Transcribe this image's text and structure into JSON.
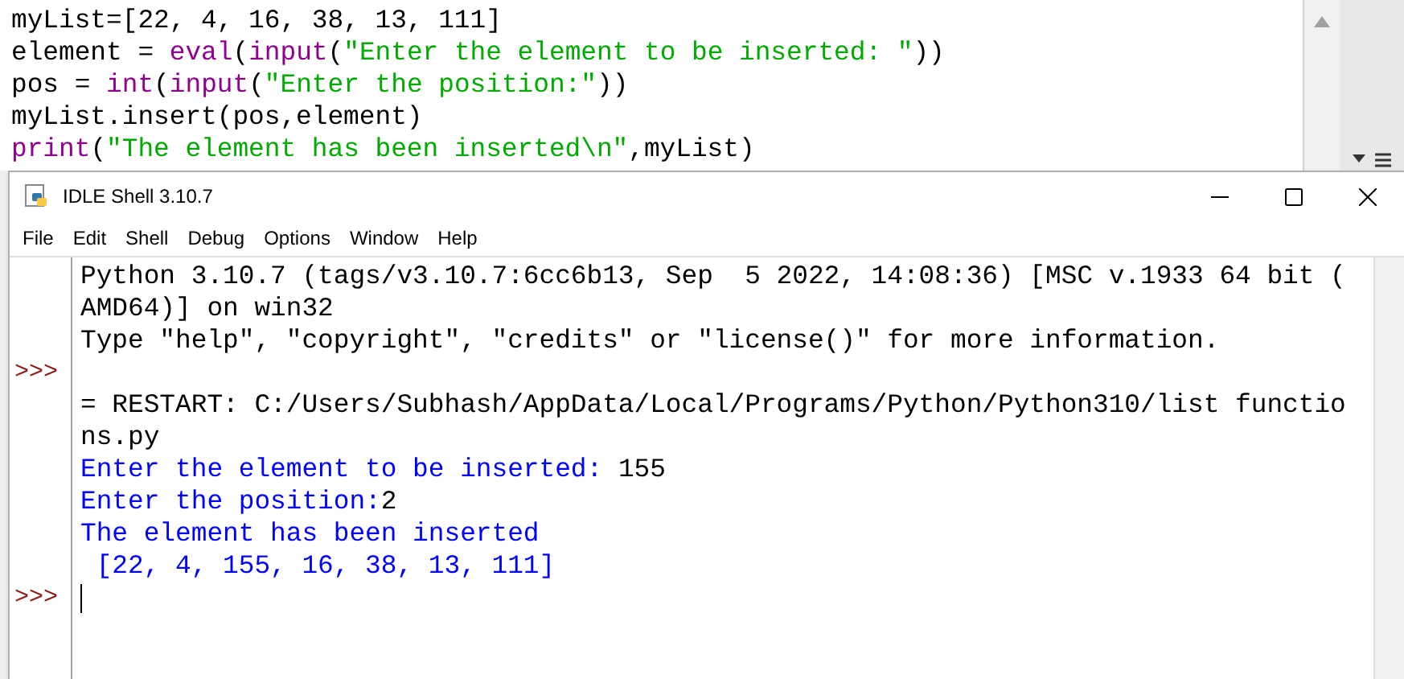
{
  "editor": {
    "lines": [
      {
        "segments": [
          {
            "text": "myList=[22, 4, 16, 38, 13, 111]",
            "kind": "plain"
          }
        ]
      },
      {
        "segments": [
          {
            "text": "element = ",
            "kind": "plain"
          },
          {
            "text": "eval",
            "kind": "builtin"
          },
          {
            "text": "(",
            "kind": "plain"
          },
          {
            "text": "input",
            "kind": "builtin"
          },
          {
            "text": "(",
            "kind": "plain"
          },
          {
            "text": "\"Enter the element to be inserted: \"",
            "kind": "string"
          },
          {
            "text": "))",
            "kind": "plain"
          }
        ]
      },
      {
        "segments": [
          {
            "text": "pos = ",
            "kind": "plain"
          },
          {
            "text": "int",
            "kind": "builtin"
          },
          {
            "text": "(",
            "kind": "plain"
          },
          {
            "text": "input",
            "kind": "builtin"
          },
          {
            "text": "(",
            "kind": "plain"
          },
          {
            "text": "\"Enter the position:\"",
            "kind": "string"
          },
          {
            "text": "))",
            "kind": "plain"
          }
        ]
      },
      {
        "segments": [
          {
            "text": "myList.insert(pos,element)",
            "kind": "plain"
          }
        ]
      },
      {
        "segments": [
          {
            "text": "print",
            "kind": "builtin"
          },
          {
            "text": "(",
            "kind": "plain"
          },
          {
            "text": "\"The element has been inserted\\n\"",
            "kind": "string"
          },
          {
            "text": ",myList)",
            "kind": "plain"
          }
        ]
      }
    ]
  },
  "shell": {
    "title": "IDLE Shell 3.10.7",
    "menu": [
      "File",
      "Edit",
      "Shell",
      "Debug",
      "Options",
      "Window",
      "Help"
    ],
    "lines": [
      {
        "segments": [
          {
            "text": "Python 3.10.7 (tags/v3.10.7:6cc6b13, Sep  5 2022, 14:08:36) [MSC v.1933 64 bit (",
            "kind": "plain"
          }
        ]
      },
      {
        "segments": [
          {
            "text": "AMD64)] on win32",
            "kind": "plain"
          }
        ]
      },
      {
        "segments": [
          {
            "text": "Type \"help\", \"copyright\", \"credits\" or \"license()\" for more information.",
            "kind": "plain"
          }
        ]
      },
      {
        "prompt": ">>>"
      },
      {
        "segments": [
          {
            "text": "= RESTART: C:/Users/Subhash/AppData/Local/Programs/Python/Python310/list functio",
            "kind": "plain"
          }
        ]
      },
      {
        "segments": [
          {
            "text": "ns.py",
            "kind": "plain"
          }
        ]
      },
      {
        "segments": [
          {
            "text": "Enter the element to be inserted: ",
            "kind": "stdout"
          },
          {
            "text": "155",
            "kind": "stdin"
          }
        ]
      },
      {
        "segments": [
          {
            "text": "Enter the position:",
            "kind": "stdout"
          },
          {
            "text": "2",
            "kind": "stdin"
          }
        ]
      },
      {
        "segments": [
          {
            "text": "The element has been inserted",
            "kind": "stdout"
          }
        ]
      },
      {
        "segments": [
          {
            "text": " [22, 4, 155, 16, 38, 13, 111]",
            "kind": "stdout"
          }
        ]
      },
      {
        "prompt": ">>>",
        "cursor": true
      }
    ]
  }
}
